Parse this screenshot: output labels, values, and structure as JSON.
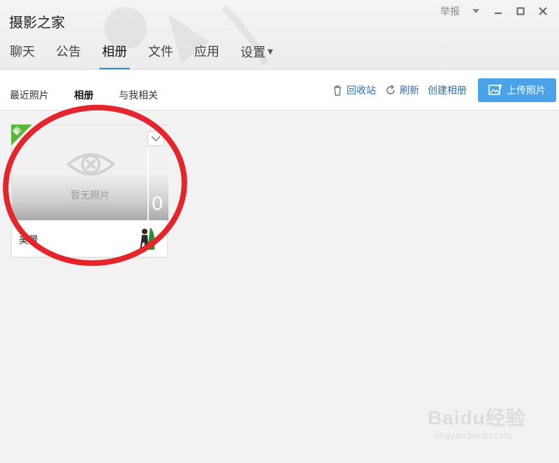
{
  "window": {
    "title": "摄影之家",
    "report_label": "举报"
  },
  "tabs": [
    {
      "label": "聊天"
    },
    {
      "label": "公告"
    },
    {
      "label": "相册",
      "active": true
    },
    {
      "label": "文件"
    },
    {
      "label": "应用"
    },
    {
      "label": "设置",
      "has_menu": true
    }
  ],
  "subtabs": [
    {
      "label": "最近照片"
    },
    {
      "label": "相册",
      "active": true
    },
    {
      "label": "与我相关"
    }
  ],
  "actions": {
    "recycle": "回收站",
    "refresh": "刷新",
    "create_album": "创建相册",
    "upload": "上传照片"
  },
  "album": {
    "badge": "新",
    "empty_text": "暂无照片",
    "count": "0",
    "name": "美景"
  },
  "watermark": {
    "brand": "Baidu经验",
    "url": "jingyan.baidu.com"
  },
  "colors": {
    "accent": "#2b8ad9",
    "upload_button": "#4aa3e8",
    "new_badge": "#5bb53b",
    "annotation": "#e4262c"
  }
}
